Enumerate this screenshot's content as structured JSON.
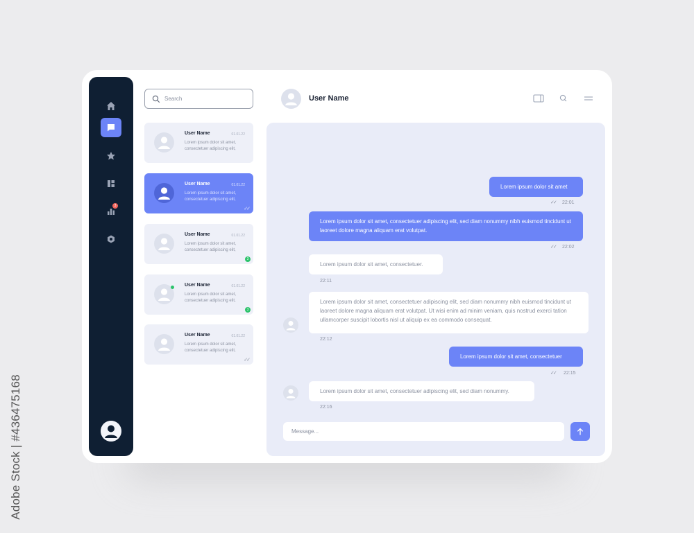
{
  "watermark": "Adobe Stock | #436475168",
  "sidebar": {
    "items": [
      {
        "icon": "home-icon",
        "active": false
      },
      {
        "icon": "chat-icon",
        "active": true
      },
      {
        "icon": "star-icon",
        "active": false
      },
      {
        "icon": "dashboard-icon",
        "active": false
      },
      {
        "icon": "bar-chart-icon",
        "active": false,
        "badge": "3"
      },
      {
        "icon": "settings-icon",
        "active": false
      }
    ],
    "profile_icon": "user-avatar"
  },
  "search": {
    "placeholder": "Search"
  },
  "chats": [
    {
      "name": "User Name",
      "date": "01.01.22",
      "preview": "Lorem ipsum dolor sit amet, consectetuer adipiscing elit,",
      "active": false
    },
    {
      "name": "User Name",
      "date": "01.01.22",
      "preview": "Lorem ipsum dolor sit amet, consectetuer adipiscing elit,",
      "active": true,
      "status": "read"
    },
    {
      "name": "User Name",
      "date": "01.01.22",
      "preview": "Lorem ipsum dolor sit amet, consectetuer adipiscing elit,",
      "active": false,
      "unread": "3"
    },
    {
      "name": "User Name",
      "date": "01.01.22",
      "preview": "Lorem ipsum dolor sit amet, consectetuer adipiscing elit,",
      "active": false,
      "unread": "3",
      "online": true
    },
    {
      "name": "User Name",
      "date": "01.01.22",
      "preview": "Lorem ipsum dolor sit amet, consectetuer adipiscing elit,",
      "active": false,
      "status": "read"
    }
  ],
  "header": {
    "name": "User Name",
    "icons": [
      "window-icon",
      "search-icon",
      "menu-icon"
    ]
  },
  "messages": [
    {
      "direction": "out",
      "text": "Lorem ipsum dolor sit amet",
      "time": "22:01"
    },
    {
      "direction": "out",
      "text": "Lorem ipsum dolor sit amet, consectetuer adipiscing elit, sed diam nonummy nibh euismod tincidunt ut laoreet dolore magna aliquam erat volutpat.",
      "time": "22:02"
    },
    {
      "direction": "in",
      "text": "Lorem ipsum dolor sit amet, consectetuer.",
      "time": "22:11"
    },
    {
      "direction": "in",
      "text": "Lorem ipsum dolor sit amet, consectetuer adipiscing elit, sed diam nonummy nibh euismod tincidunt ut laoreet dolore magna aliquam erat volutpat. Ut wisi enim ad minim veniam, quis nostrud exerci tation ullamcorper suscipit lobortis nisl ut aliquip ex ea commodo consequat.",
      "time": "22:12"
    },
    {
      "direction": "out",
      "text": "Lorem ipsum dolor sit amet, consectetuer",
      "time": "22:15"
    },
    {
      "direction": "in",
      "text": "Lorem ipsum dolor sit amet, consectetuer adipiscing elit, sed diam nonummy.",
      "time": "22:16"
    }
  ],
  "composer": {
    "placeholder": "Message...",
    "send_icon": "arrow-up-icon"
  },
  "colors": {
    "accent": "#6c84f7",
    "sidebar": "#0f1f33",
    "panel": "#e9ecf8"
  }
}
